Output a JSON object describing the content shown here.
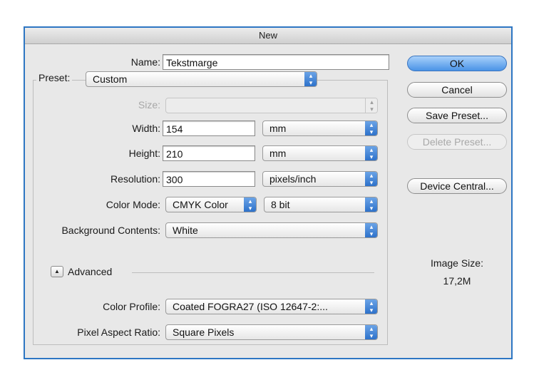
{
  "window": {
    "title": "New"
  },
  "name": {
    "label": "Name:",
    "value": "Tekstmarge"
  },
  "preset": {
    "label": "Preset:",
    "value": "Custom"
  },
  "size": {
    "label": "Size:",
    "value": ""
  },
  "width": {
    "label": "Width:",
    "value": "154",
    "unit": "mm"
  },
  "height": {
    "label": "Height:",
    "value": "210",
    "unit": "mm"
  },
  "resolution": {
    "label": "Resolution:",
    "value": "300",
    "unit": "pixels/inch"
  },
  "color_mode": {
    "label": "Color Mode:",
    "mode": "CMYK Color",
    "depth": "8 bit"
  },
  "background": {
    "label": "Background Contents:",
    "value": "White"
  },
  "advanced": {
    "label": "Advanced",
    "toggle_icon": "triangle-up-icon"
  },
  "color_profile": {
    "label": "Color Profile:",
    "value": "Coated FOGRA27 (ISO 12647-2:..."
  },
  "pixel_aspect": {
    "label": "Pixel Aspect Ratio:",
    "value": "Square Pixels"
  },
  "buttons": {
    "ok": "OK",
    "cancel": "Cancel",
    "save_preset": "Save Preset...",
    "delete_preset": "Delete Preset...",
    "device_central": "Device Central..."
  },
  "image_size": {
    "label": "Image Size:",
    "value": "17,2M"
  },
  "colors": {
    "window_border": "#2d76c3",
    "popup_arrow": "#2a6fc9",
    "default_button": "#4a93e6"
  }
}
